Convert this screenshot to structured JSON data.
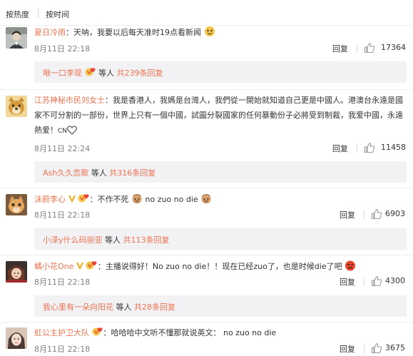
{
  "sort_tabs": {
    "hot": "按热度",
    "time": "按时间"
  },
  "comments": [
    {
      "user": "夏日冷雨",
      "separator": "：",
      "text": "天呐，我要以后每天准时19点看新闻",
      "date": "8月11日 22:18",
      "reply": "回复",
      "likes": "17364",
      "sub_users": "啾一口李现",
      "sub_mid": "等人",
      "sub_count": "共239条回复"
    },
    {
      "user": "江苏神秘市民刘女士",
      "separator": "：",
      "text": "我是香港人，我媽是台灣人，我們從一開始就知道自己更是中國人。港澳台永遠是國家不可分割的一部份，世界上只有一個中國，試圖分裂國家的任何暴動份子必將受到制裁，我爱中國，永遠熱爱！",
      "text_suffix": "CN",
      "date": "8月11日 22:24",
      "reply": "回复",
      "likes": "11458",
      "sub_users": "Ash久久恋歌",
      "sub_mid": "等人",
      "sub_count": "共316条回复"
    },
    {
      "user": "沫蔚李心",
      "separator": "：",
      "text": "不作不死",
      "text_tail": "no zuo no die",
      "date": "8月11日 22:18",
      "reply": "回复",
      "likes": "6903",
      "sub_users": "小泽y什么码丽亚",
      "sub_mid": "等人",
      "sub_count": "共113条回复"
    },
    {
      "user": "橘小花One",
      "separator": "：",
      "text": "主播说得好！No zuo no die！！现在已经zuo了，也是时候die了吧",
      "date": "8月11日 22:18",
      "reply": "回复",
      "likes": "4300",
      "sub_users": "我心里有一朵向阳花",
      "sub_mid": "等人",
      "sub_count": "共28条回复"
    },
    {
      "user": "虹公主护卫大队",
      "separator": "：",
      "text": "哈哈哈中文听不懂那就说英文： no zuo no die",
      "date": "8月11日 22:18",
      "reply": "回复",
      "likes": "3675"
    }
  ],
  "colors": {
    "accent": "#eb7350",
    "subbox": "#f2f2f5",
    "muted": "#808080"
  },
  "icons": [
    "thumbs-up-icon",
    "heart-icon",
    "vip-badge-icon",
    "emoji-icon"
  ]
}
